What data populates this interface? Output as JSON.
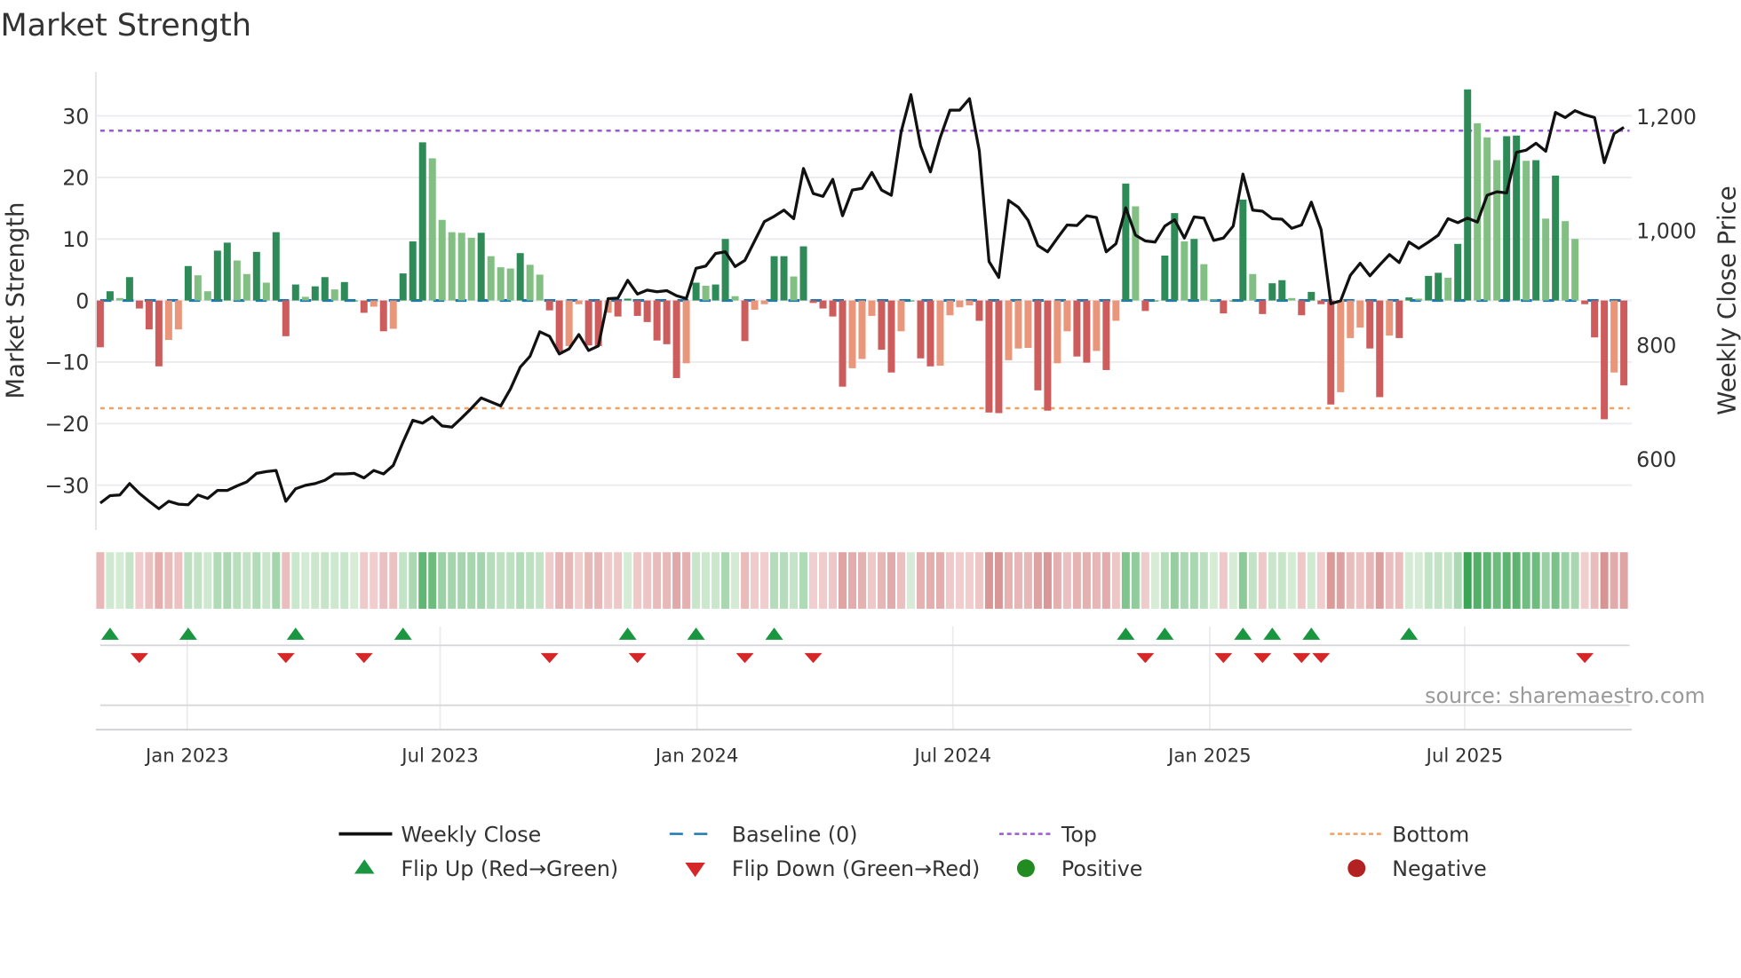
{
  "title": "Market Strength",
  "source": "source: sharemaestro.com",
  "colors": {
    "dark_green": "#2e8b57",
    "light_green": "#82bf82",
    "dark_red": "#cd5c5c",
    "light_red": "#e9967a",
    "line": "#111111",
    "baseline": "#1f77b4",
    "top": "#9b59d0",
    "bottom": "#f0a060",
    "flip_up": "#1a9641",
    "flip_down": "#d62728",
    "positive": "#228b22",
    "negative": "#b22222"
  },
  "chart_data": {
    "type": "bar+line",
    "title": "Market Strength",
    "ylabel": "Market Strength",
    "y2label": "Weekly Close Price",
    "ylim": [
      -35,
      36
    ],
    "y2lim": [
      480,
      1290
    ],
    "yticks": [
      30,
      20,
      10,
      0,
      -10,
      -20,
      -30
    ],
    "yticklabels": [
      "30",
      "20",
      "10",
      "0",
      "−10",
      "−20",
      "−30"
    ],
    "y2ticks": [
      1200,
      1000,
      800,
      600
    ],
    "y2ticklabels": [
      "1,200",
      "1,000",
      "800",
      "600"
    ],
    "xticks": [
      {
        "week": 8.9,
        "label": "Jan 2023"
      },
      {
        "week": 34.8,
        "label": "Jul 2023"
      },
      {
        "week": 61.1,
        "label": "Jan 2024"
      },
      {
        "week": 87.3,
        "label": "Jul 2024"
      },
      {
        "week": 113.6,
        "label": "Jan 2025"
      },
      {
        "week": 139.7,
        "label": "Jul 2025"
      }
    ],
    "top_level": 27.6,
    "bottom_level": -17.5,
    "baseline": 0,
    "strength": [
      -7.6,
      1.5,
      0.4,
      3.8,
      -1.3,
      -4.7,
      -10.7,
      -6.4,
      -4.7,
      5.6,
      4.1,
      1.5,
      8.1,
      9.4,
      6.5,
      4.3,
      7.9,
      2.9,
      11.1,
      -5.8,
      2.6,
      0.6,
      2.3,
      3.8,
      1.8,
      3,
      0,
      -2,
      -1,
      -5,
      -4.6,
      4.4,
      9.6,
      25.7,
      23.1,
      13.1,
      11.1,
      11,
      10.2,
      11,
      7.2,
      5.4,
      5.2,
      7.7,
      5.8,
      4.2,
      -1.6,
      -8.3,
      -7.4,
      -0.6,
      -7.3,
      -7.4,
      -2,
      -2.6,
      0.3,
      -2.5,
      -3.5,
      -6.5,
      -7.1,
      -12.6,
      -10.2,
      2.9,
      2.4,
      2.6,
      10,
      0.7,
      -6.6,
      -1.5,
      -0.6,
      7.2,
      7.2,
      3.9,
      8.8,
      -0.4,
      -1.3,
      -2.6,
      -14,
      -11,
      -9.5,
      -2.5,
      -8,
      -11.7,
      -5,
      0,
      -9.4,
      -10.7,
      -10.6,
      -2.4,
      -1.1,
      -0.8,
      -3.3,
      -18.2,
      -18.3,
      -9.7,
      -7.8,
      -7.7,
      -14.6,
      -17.9,
      -10.2,
      -5,
      -9.1,
      -10.1,
      -8.2,
      -11.3,
      -3.3,
      19,
      15.3,
      -1.7,
      0,
      7.3,
      14.2,
      9.6,
      10,
      5.9,
      0.2,
      -2.1,
      0,
      16.4,
      4.3,
      -2.2,
      2.8,
      3.3,
      0.4,
      -2.4,
      1.4,
      -0.6,
      -16.9,
      -14.9,
      -6.1,
      -4.4,
      -7.8,
      -15.7,
      -5.7,
      -6.1,
      0.5,
      0.3,
      4,
      4.5,
      3.7,
      9.2,
      34.3,
      28.8,
      26.5,
      22.8,
      26.7,
      26.8,
      22.7,
      22.8,
      13.3,
      20.3,
      12.9,
      10,
      -0.6,
      -6,
      -19.3,
      -11.7,
      -13.8
    ],
    "close": [
      523,
      536,
      537,
      557,
      540,
      526,
      513,
      526,
      521,
      520,
      537,
      531,
      545,
      545,
      553,
      560,
      575,
      578,
      580,
      526,
      548,
      554,
      557,
      563,
      574,
      574,
      575,
      567,
      580,
      574,
      589,
      630,
      668,
      663,
      674,
      658,
      656,
      672,
      689,
      707,
      700,
      693,
      723,
      761,
      780,
      823,
      815,
      784,
      793,
      818,
      790,
      798,
      881,
      882,
      913,
      889,
      896,
      893,
      895,
      886,
      881,
      934,
      938,
      960,
      963,
      937,
      948,
      982,
      1016,
      1025,
      1036,
      1021,
      1109,
      1065,
      1060,
      1090,
      1026,
      1071,
      1074,
      1102,
      1071,
      1062,
      1173,
      1238,
      1148,
      1103,
      1163,
      1211,
      1211,
      1231,
      1140,
      946,
      918,
      1053,
      1041,
      1018,
      974,
      963,
      987,
      1010,
      1009,
      1026,
      1023,
      963,
      977,
      1040,
      992,
      982,
      980,
      1008,
      1019,
      987,
      1024,
      1022,
      983,
      987,
      1008,
      1099,
      1036,
      1034,
      1021,
      1020,
      1004,
      1010,
      1050,
      1002,
      872,
      877,
      922,
      943,
      921,
      940,
      958,
      944,
      980,
      969,
      980,
      992,
      1021,
      1014,
      1022,
      1015,
      1062,
      1068,
      1066,
      1137,
      1141,
      1153,
      1139,
      1207,
      1198,
      1210,
      1203,
      1198,
      1119,
      1170,
      1181
    ],
    "flip_up_weeks": [
      1,
      9,
      20,
      31,
      54,
      61,
      69,
      105,
      109,
      117,
      120,
      124,
      134
    ],
    "flip_down_weeks": [
      4,
      19,
      27,
      46,
      55,
      66,
      73,
      107,
      115,
      119,
      123,
      125,
      152
    ]
  },
  "legend": [
    {
      "label": "Weekly Close",
      "symbol": "line"
    },
    {
      "label": "Baseline (0)",
      "symbol": "dash"
    },
    {
      "label": "Top",
      "symbol": "dot-purple"
    },
    {
      "label": "Bottom",
      "symbol": "dot-orange"
    },
    {
      "label": "Flip Up (Red→Green)",
      "symbol": "triangle-up"
    },
    {
      "label": "Flip Down (Green→Red)",
      "symbol": "triangle-down"
    },
    {
      "label": "Positive",
      "symbol": "circle-green"
    },
    {
      "label": "Negative",
      "symbol": "circle-red"
    }
  ]
}
